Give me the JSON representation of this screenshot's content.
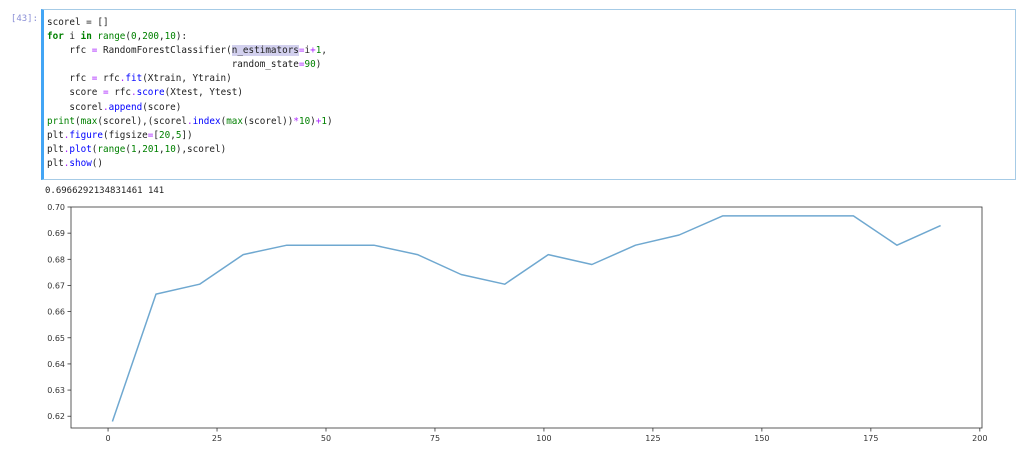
{
  "cell": {
    "prompt": "[43]:",
    "code": [
      {
        "tokens": [
          {
            "t": "scorel = []"
          }
        ]
      },
      {
        "tokens": [
          {
            "t": "for",
            "c": "kw"
          },
          {
            "t": " i "
          },
          {
            "t": "in",
            "c": "kw"
          },
          {
            "t": " "
          },
          {
            "t": "range",
            "c": "bi"
          },
          {
            "t": "("
          },
          {
            "t": "0",
            "c": "num"
          },
          {
            "t": ","
          },
          {
            "t": "200",
            "c": "num"
          },
          {
            "t": ","
          },
          {
            "t": "10",
            "c": "num"
          },
          {
            "t": "):"
          }
        ]
      },
      {
        "tokens": [
          {
            "t": "    rfc "
          },
          {
            "t": "=",
            "c": "op"
          },
          {
            "t": " RandomForestClassifier("
          },
          {
            "t": "n_estimators",
            "c": "hl"
          },
          {
            "t": "=",
            "c": "op"
          },
          {
            "t": "i"
          },
          {
            "t": "+",
            "c": "op"
          },
          {
            "t": "1",
            "c": "num"
          },
          {
            "t": ","
          }
        ]
      },
      {
        "tokens": [
          {
            "t": "                                 random_state"
          },
          {
            "t": "=",
            "c": "op"
          },
          {
            "t": "90",
            "c": "num"
          },
          {
            "t": ")"
          }
        ]
      },
      {
        "tokens": [
          {
            "t": "    rfc "
          },
          {
            "t": "=",
            "c": "op"
          },
          {
            "t": " rfc"
          },
          {
            "t": ".",
            "c": "op"
          },
          {
            "t": "fit",
            "c": "fn"
          },
          {
            "t": "(Xtrain, Ytrain)"
          }
        ]
      },
      {
        "tokens": [
          {
            "t": "    score "
          },
          {
            "t": "=",
            "c": "op"
          },
          {
            "t": " rfc"
          },
          {
            "t": ".",
            "c": "op"
          },
          {
            "t": "score",
            "c": "fn"
          },
          {
            "t": "(Xtest, Ytest)"
          }
        ]
      },
      {
        "tokens": [
          {
            "t": "    scorel"
          },
          {
            "t": ".",
            "c": "op"
          },
          {
            "t": "append",
            "c": "fn"
          },
          {
            "t": "(score)"
          }
        ]
      },
      {
        "tokens": [
          {
            "t": "print",
            "c": "bi"
          },
          {
            "t": "("
          },
          {
            "t": "max",
            "c": "bi"
          },
          {
            "t": "(scorel),(scorel"
          },
          {
            "t": ".",
            "c": "op"
          },
          {
            "t": "index",
            "c": "fn"
          },
          {
            "t": "("
          },
          {
            "t": "max",
            "c": "bi"
          },
          {
            "t": "(scorel))"
          },
          {
            "t": "*",
            "c": "op"
          },
          {
            "t": "10",
            "c": "num"
          },
          {
            "t": ")"
          },
          {
            "t": "+",
            "c": "op"
          },
          {
            "t": "1",
            "c": "num"
          },
          {
            "t": ")"
          }
        ]
      },
      {
        "tokens": [
          {
            "t": "plt"
          },
          {
            "t": ".",
            "c": "op"
          },
          {
            "t": "figure",
            "c": "fn"
          },
          {
            "t": "(figsize"
          },
          {
            "t": "=",
            "c": "op"
          },
          {
            "t": "["
          },
          {
            "t": "20",
            "c": "num"
          },
          {
            "t": ","
          },
          {
            "t": "5",
            "c": "num"
          },
          {
            "t": "])"
          }
        ]
      },
      {
        "tokens": [
          {
            "t": "plt"
          },
          {
            "t": ".",
            "c": "op"
          },
          {
            "t": "plot",
            "c": "fn"
          },
          {
            "t": "("
          },
          {
            "t": "range",
            "c": "bi"
          },
          {
            "t": "("
          },
          {
            "t": "1",
            "c": "num"
          },
          {
            "t": ","
          },
          {
            "t": "201",
            "c": "num"
          },
          {
            "t": ","
          },
          {
            "t": "10",
            "c": "num"
          },
          {
            "t": "),scorel)"
          }
        ]
      },
      {
        "tokens": [
          {
            "t": "plt"
          },
          {
            "t": ".",
            "c": "op"
          },
          {
            "t": "show",
            "c": "fn"
          },
          {
            "t": "()"
          }
        ]
      }
    ]
  },
  "output": {
    "text": "0.6966292134831461 141"
  },
  "chart_data": {
    "type": "line",
    "x": [
      1,
      11,
      21,
      31,
      41,
      51,
      61,
      71,
      81,
      91,
      101,
      111,
      121,
      131,
      141,
      151,
      161,
      171,
      181,
      191
    ],
    "series": [
      {
        "values": [
          0.618,
          0.6667,
          0.6705,
          0.6818,
          0.6854,
          0.6854,
          0.6854,
          0.6818,
          0.6742,
          0.6705,
          0.6818,
          0.678,
          0.6854,
          0.6893,
          0.6966,
          0.6966,
          0.6966,
          0.6966,
          0.6854,
          0.6929
        ],
        "color": "#6fa8d0"
      }
    ],
    "xlim": [
      -8.5,
      200.5
    ],
    "ylim": [
      0.6155,
      0.7
    ],
    "xticks": [
      0,
      25,
      50,
      75,
      100,
      125,
      150,
      175,
      200
    ],
    "yticks": [
      0.62,
      0.63,
      0.64,
      0.65,
      0.66,
      0.67,
      0.68,
      0.69,
      0.7
    ],
    "ytick_labels": [
      "0.62",
      "0.63",
      "0.64",
      "0.65",
      "0.66",
      "0.67",
      "0.68",
      "0.69",
      "0.70"
    ],
    "title": "",
    "xlabel": "",
    "ylabel": "",
    "grid": false
  }
}
